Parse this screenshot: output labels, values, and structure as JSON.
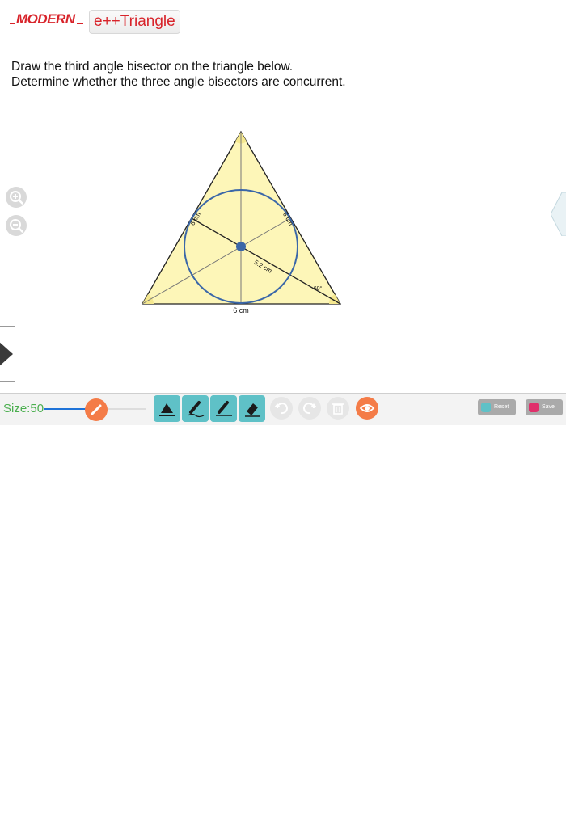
{
  "header": {
    "brand": "MODERN",
    "app_title": "e++Triangle"
  },
  "instructions": {
    "line1": "Draw the third angle bisector on the triangle below.",
    "line2": "Determine whether the three angle bisectors are concurrent."
  },
  "diagram": {
    "side_left_label": "6 cm",
    "side_right_label": "6 cm",
    "base_label": "6 cm",
    "radius_label": "5.2 cm",
    "angle_label": "60°"
  },
  "toolbar": {
    "size_label": "Size:50",
    "size_value": 50,
    "reset_label": "Reset",
    "save_label": "Save"
  },
  "colors": {
    "brand_red": "#d8232a",
    "triangle_fill": "#fdf6b8",
    "circle_stroke": "#3b67a8",
    "tool_teal": "#5fc1c7",
    "accent_orange": "#f47c48"
  }
}
